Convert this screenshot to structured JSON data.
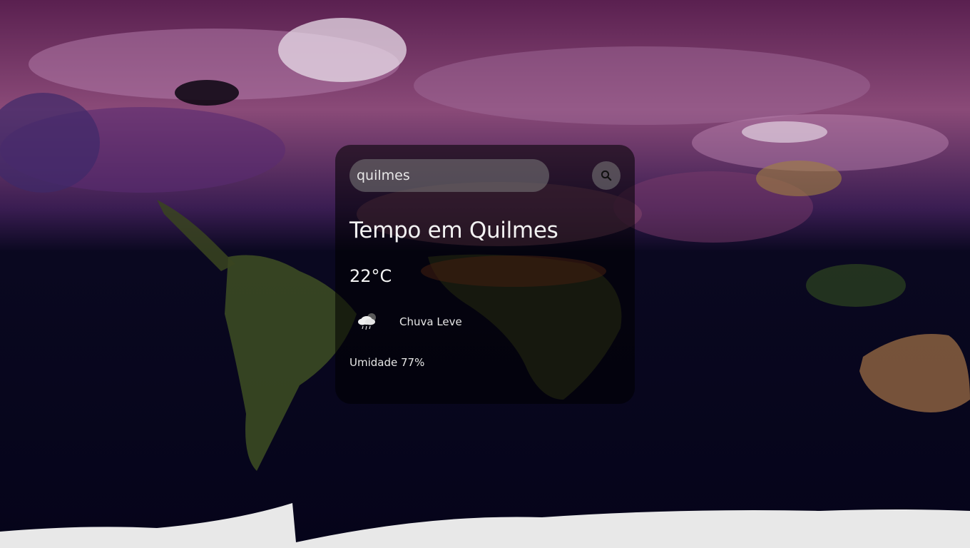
{
  "search": {
    "value": "quilmes",
    "placeholder": "Search"
  },
  "weather": {
    "title": "Tempo em Quilmes",
    "temperature": "22°C",
    "description": "Chuva Leve",
    "humidity": "Umidade 77%",
    "icon": "light-rain-cloud-icon"
  },
  "colors": {
    "card_background": "#000000",
    "input_background": "#7c7c7c",
    "text": "#ffffff"
  }
}
